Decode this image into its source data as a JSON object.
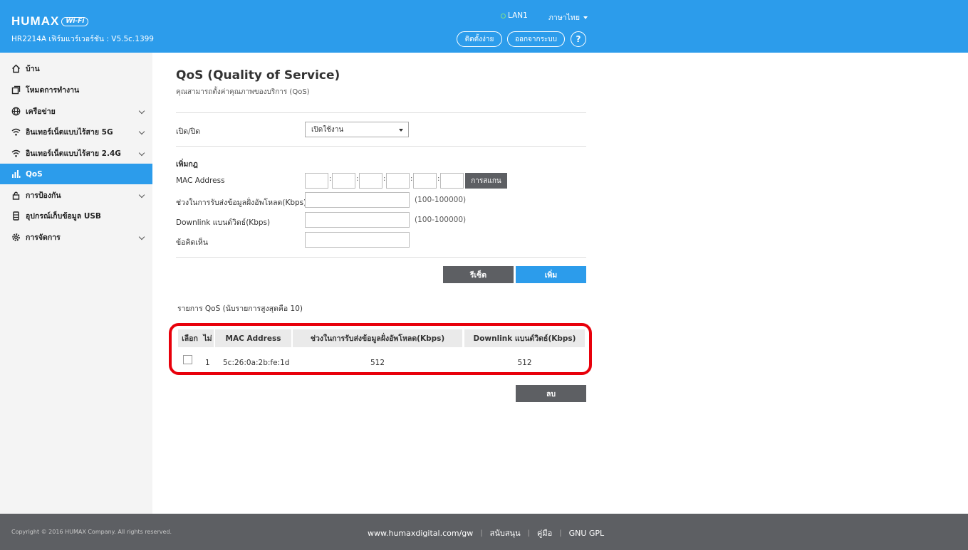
{
  "header": {
    "brand": "HUMAX",
    "wifi_badge": "Wi-Fi",
    "firmware": "HR2214A เฟิร์มแวร์เวอร์ชัน : V5.5c.1399",
    "lan_status": "LAN1",
    "language": "ภาษาไทย",
    "setup_label": "ติดตั้งง่าย",
    "logout_label": "ออกจากระบบ",
    "help_label": "?"
  },
  "sidebar": {
    "items": [
      {
        "label": "บ้าน",
        "icon": "home-icon"
      },
      {
        "label": "โหมดการทำงาน",
        "icon": "mode-icon"
      },
      {
        "label": "เครือข่าย",
        "icon": "globe-icon"
      },
      {
        "label": "อินเทอร์เน็ตแบบไร้สาย 5G",
        "icon": "wifi-icon"
      },
      {
        "label": "อินเทอร์เน็ตแบบไร้สาย 2.4G",
        "icon": "wifi-icon"
      },
      {
        "label": "QoS",
        "icon": "bar-chart-icon"
      },
      {
        "label": "การป้องกัน",
        "icon": "lock-icon"
      },
      {
        "label": "อุปกรณ์เก็บข้อมูล USB",
        "icon": "usb-storage-icon"
      },
      {
        "label": "การจัดการ",
        "icon": "gear-icon"
      }
    ]
  },
  "main": {
    "title": "QoS (Quality of Service)",
    "subtitle": "คุณสามารถตั้งค่าคุณภาพของบริการ (QoS)",
    "enable_label": "เปิด/ปิด",
    "enable_value": "เปิดใช้งาน",
    "add_rule_heading": "เพิ่มกฎ",
    "mac_label": "MAC Address",
    "mac_separator": ":",
    "scan_label": "การสแกน",
    "uplink_label": "ช่วงในการรับส่งข้อมูลฝั่งอัพโหลด(Kbps)",
    "uplink_range": "(100-100000)",
    "downlink_label": "Downlink แบนด์วิดธ์(Kbps)",
    "downlink_range": "(100-100000)",
    "comment_label": "ข้อคิดเห็น",
    "reset_label": "รีเซ็ต",
    "add_label": "เพิ่ม",
    "list_title": "รายการ QoS  (นับรายการสูงสุดคือ 10)",
    "delete_label": "ลบ"
  },
  "table": {
    "headers": [
      "เลือก",
      "ไม่",
      "MAC Address",
      "ช่วงในการรับส่งข้อมูลฝั่งอัพโหลด(Kbps)",
      "Downlink แบนด์วิดธ์(Kbps)"
    ],
    "rows": [
      {
        "no": "1",
        "mac": "5c:26:0a:2b:fe:1d",
        "uplink": "512",
        "downlink": "512"
      }
    ]
  },
  "footer": {
    "copyright": "Copyright © 2016 HUMAX Company. All rights reserved.",
    "website": "www.humaxdigital.com/gw",
    "support": "สนับสนุน",
    "manual": "คู่มือ",
    "gpl": "GNU GPL",
    "divider": "|"
  },
  "colors": {
    "accent": "#2c9ceb",
    "button_dark": "#5d5f63",
    "highlight_outline": "#e8000b"
  }
}
